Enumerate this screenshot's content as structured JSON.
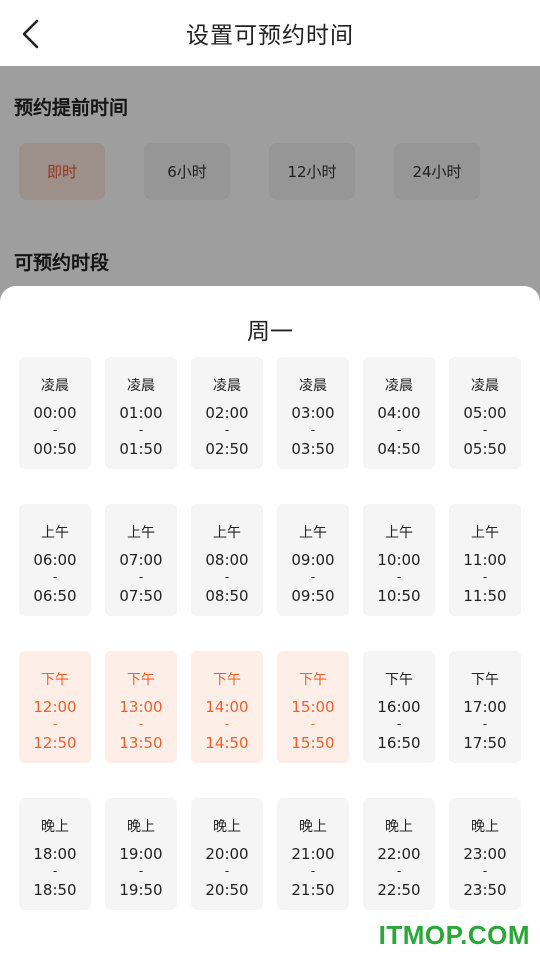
{
  "header": {
    "title": "设置可预约时间",
    "back_icon": "chevron-left-icon"
  },
  "advance": {
    "title": "预约提前时间",
    "options": [
      {
        "label": "即时",
        "selected": true
      },
      {
        "label": "6小时",
        "selected": false
      },
      {
        "label": "12小时",
        "selected": false
      },
      {
        "label": "24小时",
        "selected": false
      }
    ]
  },
  "periods": {
    "title": "可预约时段"
  },
  "sheet": {
    "title": "周一",
    "dash": "-",
    "slots": [
      {
        "period": "凌晨",
        "start": "00:00",
        "end": "00:50",
        "selected": false
      },
      {
        "period": "凌晨",
        "start": "01:00",
        "end": "01:50",
        "selected": false
      },
      {
        "period": "凌晨",
        "start": "02:00",
        "end": "02:50",
        "selected": false
      },
      {
        "period": "凌晨",
        "start": "03:00",
        "end": "03:50",
        "selected": false
      },
      {
        "period": "凌晨",
        "start": "04:00",
        "end": "04:50",
        "selected": false
      },
      {
        "period": "凌晨",
        "start": "05:00",
        "end": "05:50",
        "selected": false
      },
      {
        "period": "上午",
        "start": "06:00",
        "end": "06:50",
        "selected": false
      },
      {
        "period": "上午",
        "start": "07:00",
        "end": "07:50",
        "selected": false
      },
      {
        "period": "上午",
        "start": "08:00",
        "end": "08:50",
        "selected": false
      },
      {
        "period": "上午",
        "start": "09:00",
        "end": "09:50",
        "selected": false
      },
      {
        "period": "上午",
        "start": "10:00",
        "end": "10:50",
        "selected": false
      },
      {
        "period": "上午",
        "start": "11:00",
        "end": "11:50",
        "selected": false
      },
      {
        "period": "下午",
        "start": "12:00",
        "end": "12:50",
        "selected": true
      },
      {
        "period": "下午",
        "start": "13:00",
        "end": "13:50",
        "selected": true
      },
      {
        "period": "下午",
        "start": "14:00",
        "end": "14:50",
        "selected": true
      },
      {
        "period": "下午",
        "start": "15:00",
        "end": "15:50",
        "selected": true
      },
      {
        "period": "下午",
        "start": "16:00",
        "end": "16:50",
        "selected": false
      },
      {
        "period": "下午",
        "start": "17:00",
        "end": "17:50",
        "selected": false
      },
      {
        "period": "晚上",
        "start": "18:00",
        "end": "18:50",
        "selected": false
      },
      {
        "period": "晚上",
        "start": "19:00",
        "end": "19:50",
        "selected": false
      },
      {
        "period": "晚上",
        "start": "20:00",
        "end": "20:50",
        "selected": false
      },
      {
        "period": "晚上",
        "start": "21:00",
        "end": "21:50",
        "selected": false
      },
      {
        "period": "晚上",
        "start": "22:00",
        "end": "22:50",
        "selected": false
      },
      {
        "period": "晚上",
        "start": "23:00",
        "end": "23:50",
        "selected": false
      }
    ]
  },
  "colors": {
    "accent": "#f05a22",
    "selected_bg": "#fdeee7",
    "slot_bg": "#f5f5f5",
    "watermark": "#2aa836"
  },
  "watermark": "ITMOP.COM"
}
